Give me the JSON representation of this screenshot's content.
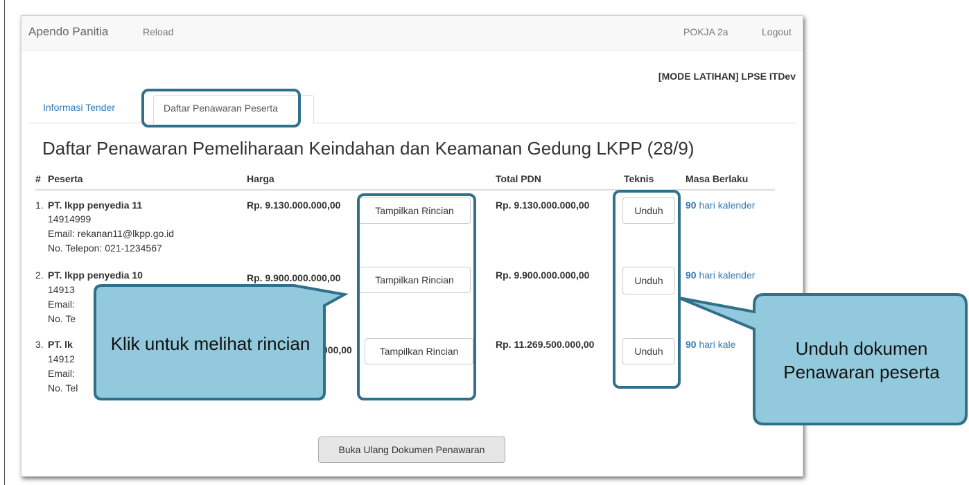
{
  "navbar": {
    "brand": "Apendo Panitia",
    "reload": "Reload",
    "user": "POKJA 2a",
    "logout": "Logout"
  },
  "mode_label": "[MODE LATIHAN] LPSE ITDev",
  "tabs": [
    {
      "label": "Informasi Tender"
    },
    {
      "label": "Daftar Penawaran Peserta"
    }
  ],
  "title": "Daftar Penawaran Pemeliharaan Keindahan dan Keamanan Gedung LKPP (28/9)",
  "table": {
    "headers": [
      "#",
      "Peserta",
      "Harga",
      "Total PDN",
      "Teknis",
      "Masa Berlaku"
    ],
    "rows": [
      {
        "num": "1.",
        "name": "PT. lkpp penyedia 11",
        "npwp": "14914999",
        "email": "Email: rekanan11@lkpp.go.id",
        "phone": "No. Telepon: 021-1234567",
        "harga": "Rp. 9.130.000.000,00",
        "total": "Rp. 9.130.000.000,00",
        "days": "90",
        "days_suffix": " hari kalender"
      },
      {
        "num": "2.",
        "name": "PT. lkpp penyedia 10",
        "npwp": "14913",
        "email": "Email:",
        "phone": "No. Te",
        "harga": "Rp. 9.900.000.000,00",
        "total": "Rp. 9.900.000.000,00",
        "days": "90",
        "days_suffix": " hari kalender"
      },
      {
        "num": "3.",
        "name": "PT. lk",
        "npwp": "14912",
        "email": "Email:",
        "phone": "No. Tel",
        "harga": "000,00",
        "total": "Rp. 11.269.500.000,00",
        "days": "90",
        "days_suffix": " hari kale"
      }
    ],
    "rincian_label": "Tampilkan Rincian",
    "unduh_label": "Unduh"
  },
  "reopen_button": "Buka Ulang Dokumen Penawaran",
  "callouts": {
    "left": "Klik untuk melihat rincian",
    "right": "Unduh dokumen Penawaran peserta"
  },
  "colors": {
    "callout_fill": "#92c9dc",
    "callout_border": "#31708a",
    "link": "#337ab7"
  }
}
